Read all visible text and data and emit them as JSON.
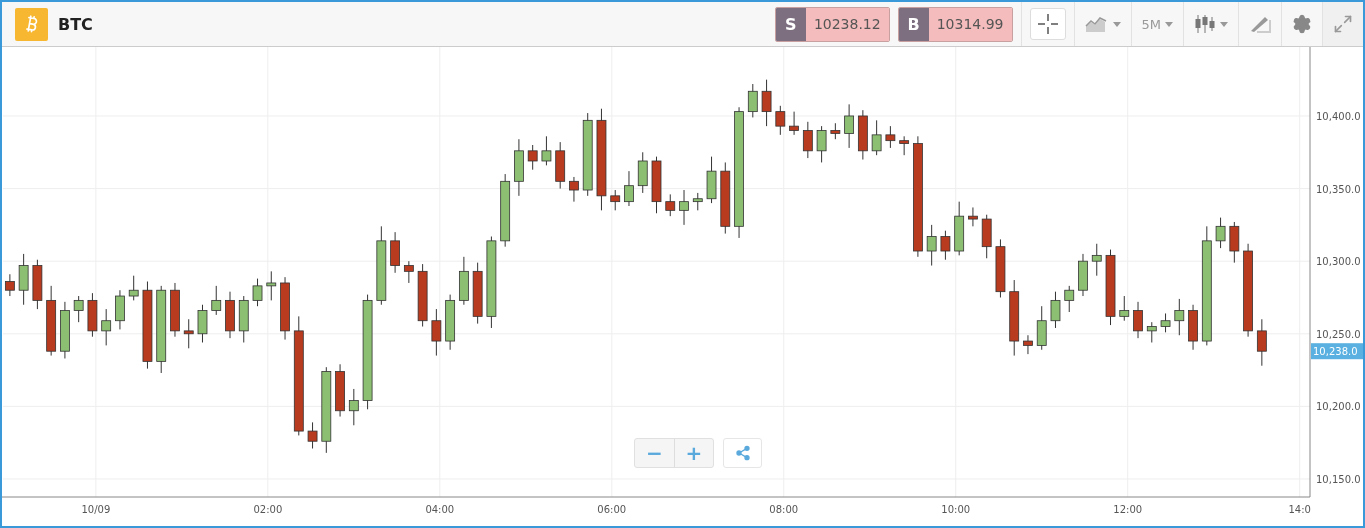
{
  "header": {
    "symbol": "BTC",
    "sell": {
      "label": "S",
      "price": "10238.12"
    },
    "buy": {
      "label": "B",
      "price": "10314.99"
    },
    "timeframe": "5M"
  },
  "chart": {
    "chart_data": {
      "type": "candlestick",
      "grid": true,
      "xlim": [
        -1.08,
        14.12
      ],
      "ylim": [
        10137.6,
        10447.5
      ],
      "xticks": [
        {
          "value": 0,
          "label": "10/09"
        },
        {
          "value": 2,
          "label": "02:00"
        },
        {
          "value": 4,
          "label": "04:00"
        },
        {
          "value": 6,
          "label": "06:00"
        },
        {
          "value": 8,
          "label": "08:00"
        },
        {
          "value": 10,
          "label": "10:00"
        },
        {
          "value": 12,
          "label": "12:00"
        },
        {
          "value": 14,
          "label": "14:0"
        }
      ],
      "yticks": [
        {
          "value": 10150,
          "label": "10,150.0"
        },
        {
          "value": 10200,
          "label": "10,200.0"
        },
        {
          "value": 10250,
          "label": "10,250.0"
        },
        {
          "value": 10300,
          "label": "10,300.0"
        },
        {
          "value": 10350,
          "label": "10,350.0"
        },
        {
          "value": 10400,
          "label": "10,400.0"
        }
      ],
      "x": [
        -1,
        -0.84,
        -0.68,
        -0.52,
        -0.36,
        -0.2,
        -0.04,
        0.12,
        0.28,
        0.44,
        0.6,
        0.76,
        0.92,
        1.08,
        1.24,
        1.4,
        1.56,
        1.72,
        1.88,
        2.04,
        2.2,
        2.36,
        2.52,
        2.68,
        2.84,
        3,
        3.16,
        3.32,
        3.48,
        3.64,
        3.8,
        3.96,
        4.12,
        4.28,
        4.44,
        4.6,
        4.76,
        4.92,
        5.08,
        5.24,
        5.4,
        5.56,
        5.72,
        5.88,
        6.04,
        6.2,
        6.36,
        6.52,
        6.68,
        6.84,
        7,
        7.16,
        7.32,
        7.48,
        7.64,
        7.8,
        7.96,
        8.12,
        8.28,
        8.44,
        8.6,
        8.76,
        8.92,
        9.08,
        9.24,
        9.4,
        9.56,
        9.72,
        9.88,
        10.04,
        10.2,
        10.36,
        10.52,
        10.68,
        10.84,
        11,
        11.16,
        11.32,
        11.48,
        11.64,
        11.8,
        11.96,
        12.12,
        12.28,
        12.44,
        12.6,
        12.76,
        12.92,
        13.08,
        13.24,
        13.4,
        13.56
      ],
      "ohlc": [
        [
          10286,
          10291,
          10276,
          10280
        ],
        [
          10280,
          10305,
          10270,
          10297
        ],
        [
          10297,
          10301,
          10267,
          10273
        ],
        [
          10273,
          10283,
          10235,
          10238
        ],
        [
          10238,
          10272,
          10233,
          10266
        ],
        [
          10266,
          10276,
          10258,
          10273
        ],
        [
          10273,
          10278,
          10248,
          10252
        ],
        [
          10252,
          10267,
          10242,
          10259
        ],
        [
          10259,
          10280,
          10253,
          10276
        ],
        [
          10276,
          10290,
          10273,
          10280
        ],
        [
          10280,
          10286,
          10226,
          10231
        ],
        [
          10231,
          10283,
          10223,
          10280
        ],
        [
          10280,
          10285,
          10248,
          10252
        ],
        [
          10252,
          10260,
          10240,
          10250
        ],
        [
          10250,
          10270,
          10244,
          10266
        ],
        [
          10266,
          10283,
          10263,
          10273
        ],
        [
          10273,
          10279,
          10247,
          10252
        ],
        [
          10252,
          10276,
          10244,
          10273
        ],
        [
          10273,
          10288,
          10269,
          10283
        ],
        [
          10283,
          10293,
          10273,
          10285
        ],
        [
          10285,
          10289,
          10246,
          10252
        ],
        [
          10252,
          10262,
          10180,
          10183
        ],
        [
          10183,
          10189,
          10171,
          10176
        ],
        [
          10176,
          10227,
          10168,
          10224
        ],
        [
          10224,
          10229,
          10193,
          10197
        ],
        [
          10197,
          10212,
          10187,
          10204
        ],
        [
          10204,
          10277,
          10198,
          10273
        ],
        [
          10273,
          10324,
          10270,
          10314
        ],
        [
          10314,
          10320,
          10292,
          10297
        ],
        [
          10297,
          10300,
          10285,
          10293
        ],
        [
          10293,
          10298,
          10255,
          10259
        ],
        [
          10259,
          10267,
          10235,
          10245
        ],
        [
          10245,
          10277,
          10239,
          10273
        ],
        [
          10273,
          10303,
          10270,
          10293
        ],
        [
          10293,
          10299,
          10257,
          10262
        ],
        [
          10262,
          10317,
          10254,
          10314
        ],
        [
          10314,
          10360,
          10310,
          10355
        ],
        [
          10355,
          10384,
          10345,
          10376
        ],
        [
          10376,
          10380,
          10363,
          10369
        ],
        [
          10369,
          10386,
          10366,
          10376
        ],
        [
          10376,
          10382,
          10350,
          10355
        ],
        [
          10355,
          10358,
          10341,
          10349
        ],
        [
          10349,
          10402,
          10345,
          10397
        ],
        [
          10397,
          10405,
          10335,
          10345
        ],
        [
          10345,
          10349,
          10335,
          10341
        ],
        [
          10341,
          10362,
          10338,
          10352
        ],
        [
          10352,
          10375,
          10347,
          10369
        ],
        [
          10369,
          10372,
          10333,
          10341
        ],
        [
          10341,
          10346,
          10331,
          10335
        ],
        [
          10335,
          10349,
          10325,
          10341
        ],
        [
          10341,
          10347,
          10335,
          10343
        ],
        [
          10343,
          10372,
          10340,
          10362
        ],
        [
          10362,
          10368,
          10319,
          10324
        ],
        [
          10324,
          10406,
          10316,
          10403
        ],
        [
          10403,
          10422,
          10399,
          10417
        ],
        [
          10417,
          10425,
          10393,
          10403
        ],
        [
          10403,
          10407,
          10387,
          10393
        ],
        [
          10393,
          10403,
          10387,
          10390
        ],
        [
          10390,
          10396,
          10371,
          10376
        ],
        [
          10376,
          10393,
          10368,
          10390
        ],
        [
          10390,
          10395,
          10384,
          10388
        ],
        [
          10388,
          10408,
          10378,
          10400
        ],
        [
          10400,
          10404,
          10370,
          10376
        ],
        [
          10376,
          10397,
          10373,
          10387
        ],
        [
          10387,
          10393,
          10378,
          10383
        ],
        [
          10383,
          10386,
          10373,
          10381
        ],
        [
          10381,
          10386,
          10303,
          10307
        ],
        [
          10307,
          10325,
          10297,
          10317
        ],
        [
          10317,
          10321,
          10301,
          10307
        ],
        [
          10307,
          10341,
          10304,
          10331
        ],
        [
          10331,
          10337,
          10324,
          10329
        ],
        [
          10329,
          10332,
          10302,
          10310
        ],
        [
          10310,
          10315,
          10275,
          10279
        ],
        [
          10279,
          10287,
          10235,
          10245
        ],
        [
          10245,
          10249,
          10236,
          10242
        ],
        [
          10242,
          10269,
          10239,
          10259
        ],
        [
          10259,
          10279,
          10254,
          10273
        ],
        [
          10273,
          10283,
          10265,
          10280
        ],
        [
          10280,
          10305,
          10276,
          10300
        ],
        [
          10300,
          10312,
          10290,
          10304
        ],
        [
          10304,
          10308,
          10256,
          10262
        ],
        [
          10262,
          10276,
          10259,
          10266
        ],
        [
          10266,
          10272,
          10247,
          10252
        ],
        [
          10252,
          10258,
          10244,
          10255
        ],
        [
          10255,
          10264,
          10251,
          10259
        ],
        [
          10259,
          10274,
          10249,
          10266
        ],
        [
          10266,
          10270,
          10239,
          10245
        ],
        [
          10245,
          10324,
          10242,
          10314
        ],
        [
          10314,
          10330,
          10309,
          10324
        ],
        [
          10324,
          10327,
          10299,
          10307
        ],
        [
          10307,
          10312,
          10248,
          10252
        ],
        [
          10252,
          10260,
          10228,
          10238
        ]
      ]
    },
    "annotations": [
      {
        "label": "10,238.0"
      }
    ]
  },
  "zoom_controls": {
    "minus": "−",
    "plus": "+"
  }
}
